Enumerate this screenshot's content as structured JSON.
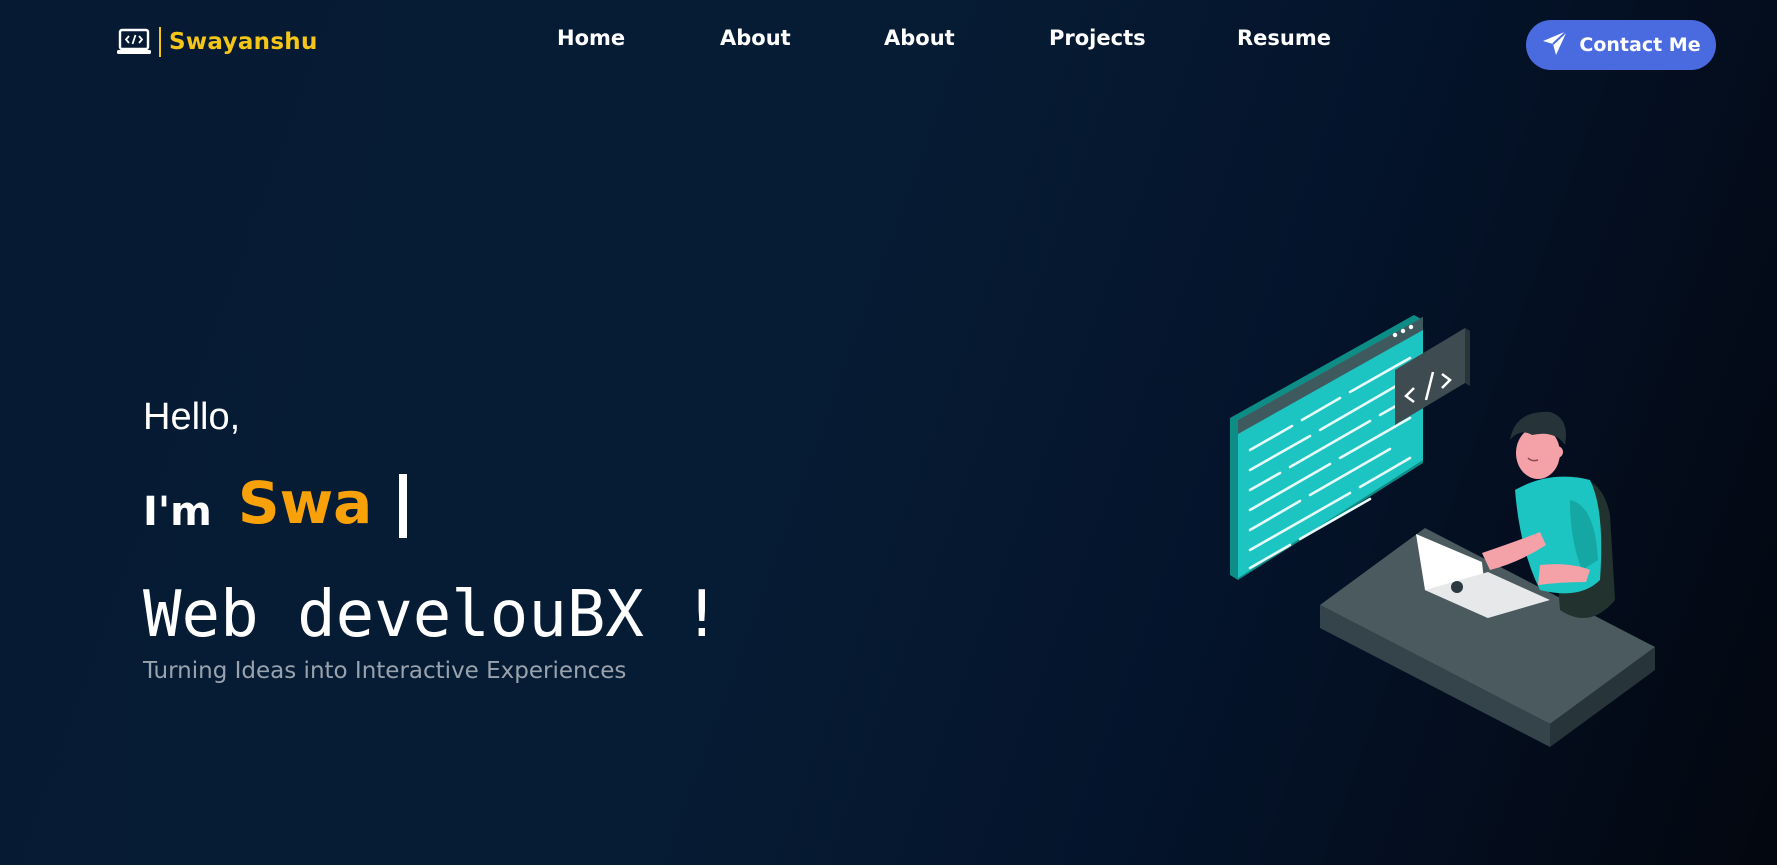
{
  "header": {
    "logo": {
      "icon": "laptop-code-icon",
      "text": "Swayanshu",
      "color": "#f5c518"
    },
    "nav": [
      {
        "label": "Home"
      },
      {
        "label": "About"
      },
      {
        "label": "About"
      },
      {
        "label": "Projects"
      },
      {
        "label": "Resume"
      }
    ],
    "contact_button": {
      "label": "Contact Me",
      "icon": "paper-plane-icon",
      "color": "#4a6be0"
    }
  },
  "hero": {
    "greeting": "Hello,",
    "intro": "I'm",
    "typed_name": "Swa",
    "name_color": "#f9a109",
    "role": "Web develouBX !",
    "tagline": "Turning Ideas into Interactive Experiences",
    "illustration": {
      "icon": "developer-at-desk-illustration",
      "code_badge": "</>"
    }
  }
}
